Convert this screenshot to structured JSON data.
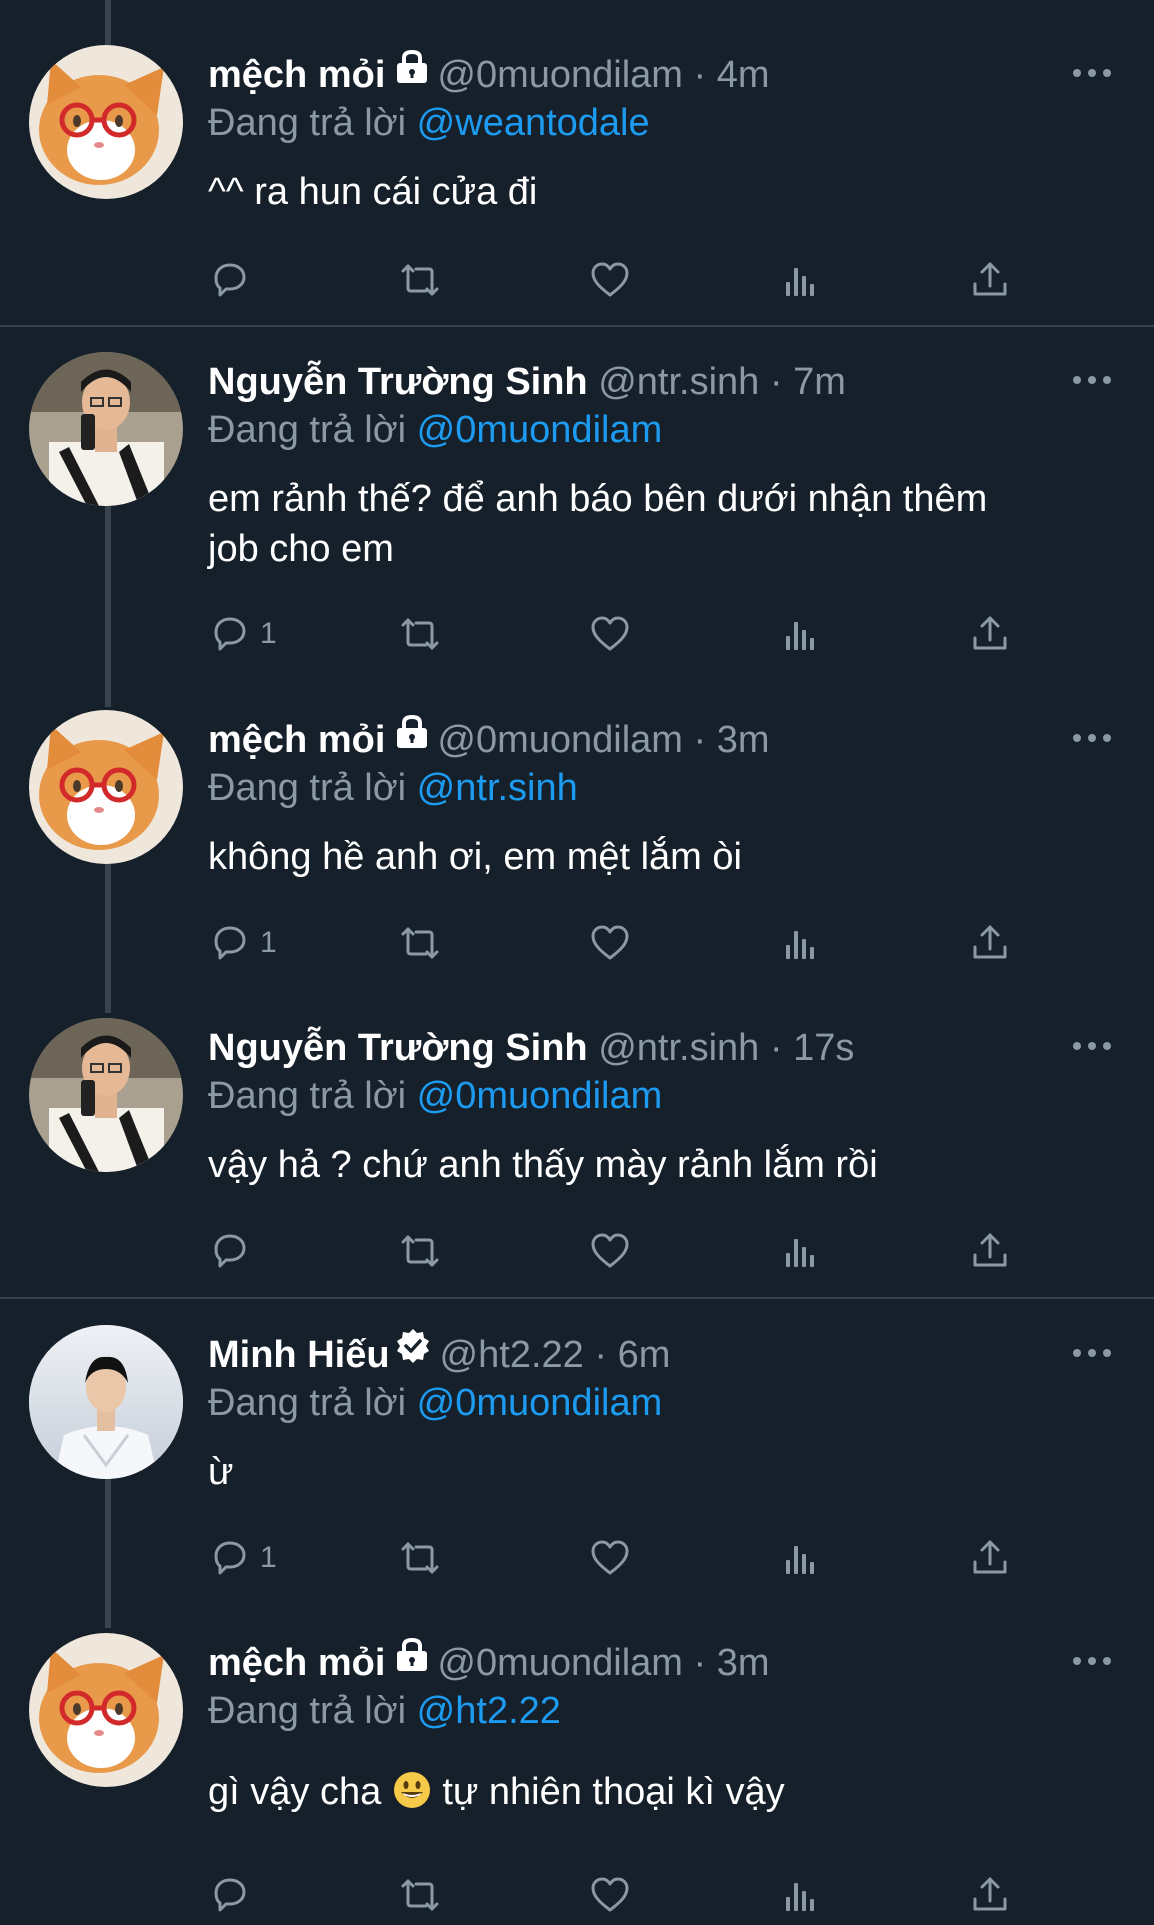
{
  "reply_prefix": "Đang trả lời",
  "colors": {
    "background": "#15202b",
    "accent": "#1d9bf0",
    "muted": "#8b98a5",
    "line": "#38444d"
  },
  "tweets": [
    {
      "name": "mệch mỏi",
      "badge": "lock-icon",
      "handle": "@0muondilam",
      "dot": "·",
      "time": "4m",
      "reply_to": "@weantodale",
      "text": "^^ ra hun cái cửa đi",
      "reply_count": ""
    },
    {
      "name": "Nguyễn Trường Sinh",
      "badge": "",
      "handle": "@ntr.sinh",
      "dot": "·",
      "time": "7m",
      "reply_to": "@0muondilam",
      "text_lines": [
        "em rảnh thế? để anh báo bên dưới nhận thêm",
        "job cho em"
      ],
      "reply_count": "1"
    },
    {
      "name": "mệch mỏi",
      "badge": "lock-icon",
      "handle": "@0muondilam",
      "dot": "·",
      "time": "3m",
      "reply_to": "@ntr.sinh",
      "text": "không hề anh ơi, em mệt lắm òi",
      "reply_count": "1"
    },
    {
      "name": "Nguyễn Trường Sinh",
      "badge": "",
      "handle": "@ntr.sinh",
      "dot": "·",
      "time": "17s",
      "reply_to": "@0muondilam",
      "text": "vậy hả ? chứ anh thấy mày rảnh lắm rồi",
      "reply_count": ""
    },
    {
      "name": "Minh Hiếu",
      "badge": "verified-icon",
      "handle": "@ht2.22",
      "dot": "·",
      "time": "6m",
      "reply_to": "@0muondilam",
      "text": "ừ",
      "reply_count": "1"
    },
    {
      "name": "mệch mỏi",
      "badge": "lock-icon",
      "handle": "@0muondilam",
      "dot": "·",
      "time": "3m",
      "reply_to": "@ht2.22",
      "text_before_emoji": "gì vậy cha",
      "emoji": "grinning-face-emoji",
      "text_after_emoji": "tự nhiên thoại kì vậy",
      "reply_count": ""
    }
  ]
}
